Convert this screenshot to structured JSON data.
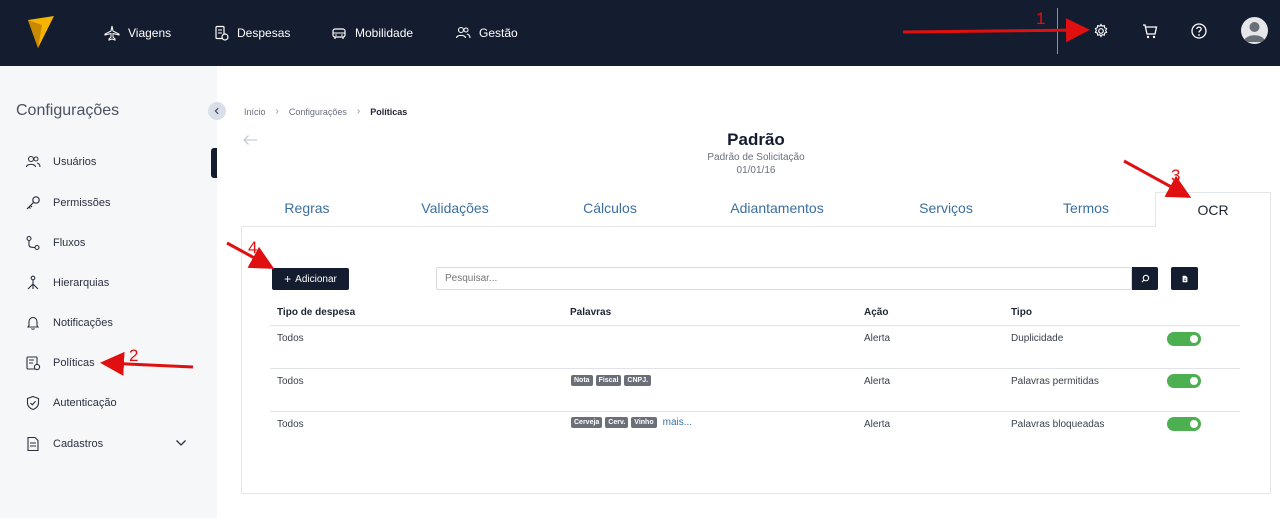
{
  "topnav": {
    "items": [
      {
        "label": "Viagens",
        "icon": "plane-icon"
      },
      {
        "label": "Despesas",
        "icon": "receipt-icon"
      },
      {
        "label": "Mobilidade",
        "icon": "car-icon"
      },
      {
        "label": "Gestão",
        "icon": "users-icon"
      }
    ],
    "icons": [
      "gear-icon",
      "cart-icon",
      "help-icon",
      "avatar-icon"
    ]
  },
  "sidebar": {
    "title": "Configurações",
    "items": [
      {
        "label": "Usuários",
        "icon": "users-icon"
      },
      {
        "label": "Permissões",
        "icon": "key-icon"
      },
      {
        "label": "Fluxos",
        "icon": "flow-icon"
      },
      {
        "label": "Hierarquias",
        "icon": "hierarchy-icon"
      },
      {
        "label": "Notificações",
        "icon": "bell-icon"
      },
      {
        "label": "Políticas",
        "icon": "policy-icon"
      },
      {
        "label": "Autenticação",
        "icon": "shield-icon"
      },
      {
        "label": "Cadastros",
        "icon": "document-icon"
      }
    ]
  },
  "breadcrumb": {
    "items": [
      "Início",
      "Configurações",
      "Políticas"
    ]
  },
  "page": {
    "title": "Padrão",
    "subtitle": "Padrão de Solicitação",
    "date": "01/01/16"
  },
  "tabs": [
    {
      "label": "Regras"
    },
    {
      "label": "Validações"
    },
    {
      "label": "Cálculos"
    },
    {
      "label": "Adiantamentos"
    },
    {
      "label": "Serviços"
    },
    {
      "label": "Termos"
    },
    {
      "label": "OCR",
      "active": true
    }
  ],
  "toolbar": {
    "add_label": "Adicionar",
    "search_placeholder": "Pesquisar..."
  },
  "table": {
    "columns": [
      "Tipo de despesa",
      "Palavras",
      "Ação",
      "Tipo"
    ],
    "rows": [
      {
        "tipo_despesa": "Todos",
        "palavras": [],
        "more": "",
        "acao": "Alerta",
        "tipo": "Duplicidade",
        "enabled": true
      },
      {
        "tipo_despesa": "Todos",
        "palavras": [
          "Nota",
          "Fiscal",
          "CNPJ."
        ],
        "more": "",
        "acao": "Alerta",
        "tipo": "Palavras permitidas",
        "enabled": true
      },
      {
        "tipo_despesa": "Todos",
        "palavras": [
          "Cerveja",
          "Cerv.",
          "Vinho"
        ],
        "more": "mais...",
        "acao": "Alerta",
        "tipo": "Palavras bloqueadas",
        "enabled": true
      }
    ]
  },
  "annotations": [
    "1",
    "2",
    "3",
    "4"
  ],
  "colors": {
    "topbar": "#141c2f",
    "accent": "#3a6fa0",
    "toggle_on": "#4caf50",
    "annotation": "#e01010",
    "logo": "#f5b400"
  }
}
